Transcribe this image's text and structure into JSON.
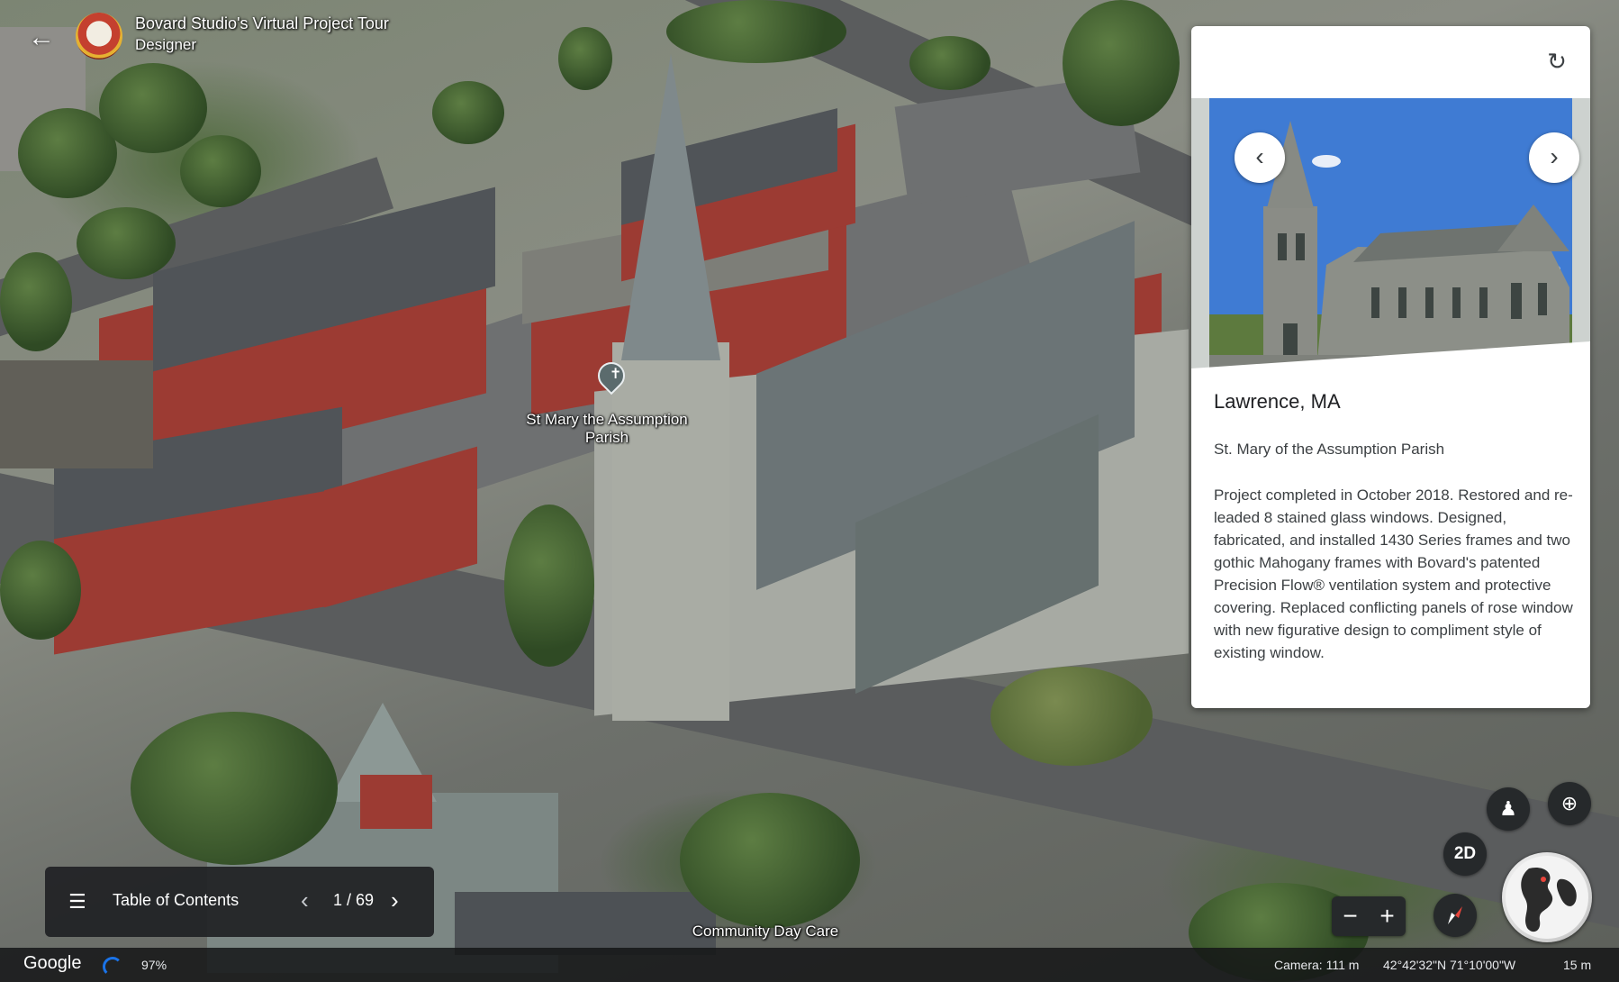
{
  "header": {
    "title": "Bovard Studio's Virtual Project Tour",
    "subtitle": "Designer"
  },
  "map_labels": {
    "church": "St Mary the Assumption Parish",
    "daycare": "Community Day Care"
  },
  "info_card": {
    "heading": "Lawrence, MA",
    "place_name": "St. Mary of the Assumption Parish",
    "description": "Project completed in October 2018. Restored and re-leaded 8 stained glass windows. Designed, fabricated, and installed 1430 Series frames and two gothic Mahogany frames with Bovard's patented Precision Flow® ventilation system and protective covering. Replaced conflicting panels of rose window with new figurative design to compliment style of existing window."
  },
  "controls": {
    "view_mode": "2D"
  },
  "toc": {
    "label": "Table of Contents",
    "page": "1 / 69"
  },
  "status_bar": {
    "logo": "Google",
    "load_percent": "97%",
    "camera": "Camera: 111 m",
    "coordinates": "42°42'32\"N 71°10'00\"W",
    "scale": "15 m"
  },
  "icons": {
    "back": "arrow-left-icon",
    "refresh": "refresh-icon",
    "prev": "chevron-left-icon",
    "next": "chevron-right-icon",
    "toc": "list-icon",
    "street_view": "pegman-icon",
    "locate": "crosshair-icon",
    "compass": "compass-icon",
    "globe": "globe-icon"
  },
  "colors": {
    "card_bg": "#ffffff",
    "control_bg": "#26292b",
    "toc_bg": "#202124",
    "accent": "#1a73e8"
  }
}
